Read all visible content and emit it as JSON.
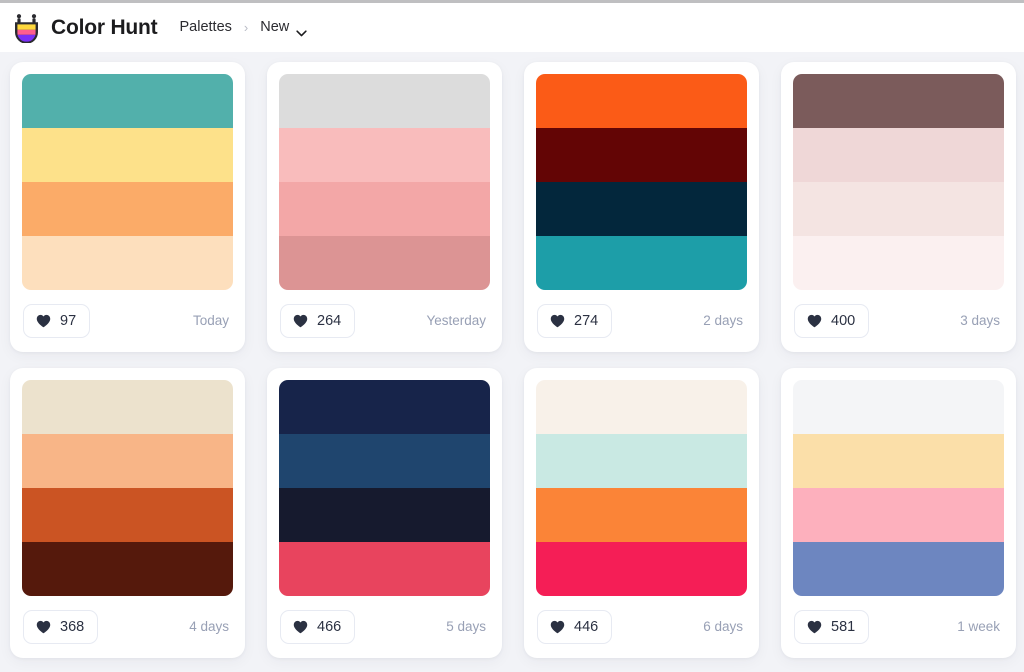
{
  "header": {
    "brand": "Color Hunt",
    "logo_icon": "colorhunt-logo-icon",
    "breadcrumb": {
      "parent": "Palettes",
      "separator": "›",
      "current": "New",
      "chevron_icon": "chevron-down-icon"
    }
  },
  "colors": {
    "page_background": "#ffffff",
    "board_background": "#f2f3f7",
    "card_background": "#ffffff",
    "text_primary": "#2b2b30",
    "text_muted": "#98a0b5",
    "heart_color": "#2b3142",
    "border": "#e7eaf2",
    "chrome_strip": "#bfbfc1"
  },
  "palettes": [
    {
      "id": "palette-1",
      "swatches": [
        "#52b0ab",
        "#fde18a",
        "#fbab68",
        "#fddfbd"
      ],
      "likes": "97",
      "time": "Today",
      "like_icon": "heart-icon"
    },
    {
      "id": "palette-2",
      "swatches": [
        "#dcdcdc",
        "#f9bcbc",
        "#f3a7a7",
        "#dc9494"
      ],
      "likes": "264",
      "time": "Yesterday",
      "like_icon": "heart-icon"
    },
    {
      "id": "palette-3",
      "swatches": [
        "#fb5b17",
        "#630505",
        "#03273c",
        "#1d9ea8"
      ],
      "likes": "274",
      "time": "2 days",
      "like_icon": "heart-icon"
    },
    {
      "id": "palette-4",
      "swatches": [
        "#7b5b5b",
        "#efd7d7",
        "#f4e4e2",
        "#fbf0f0"
      ],
      "likes": "400",
      "time": "3 days",
      "like_icon": "heart-icon"
    },
    {
      "id": "palette-5",
      "swatches": [
        "#ece2cd",
        "#f8b587",
        "#cb5423",
        "#55190c"
      ],
      "likes": "368",
      "time": "4 days",
      "like_icon": "heart-icon"
    },
    {
      "id": "palette-6",
      "swatches": [
        "#17244a",
        "#1f456e",
        "#161a2e",
        "#e8445e"
      ],
      "likes": "466",
      "time": "5 days",
      "like_icon": "heart-icon"
    },
    {
      "id": "palette-7",
      "swatches": [
        "#f8f1e9",
        "#c9e9e3",
        "#fb8437",
        "#f51e56"
      ],
      "likes": "446",
      "time": "6 days",
      "like_icon": "heart-icon"
    },
    {
      "id": "palette-8",
      "swatches": [
        "#f4f5f7",
        "#fbdfa9",
        "#fdb0bd",
        "#6d86c0"
      ],
      "likes": "581",
      "time": "1 week",
      "like_icon": "heart-icon"
    }
  ]
}
